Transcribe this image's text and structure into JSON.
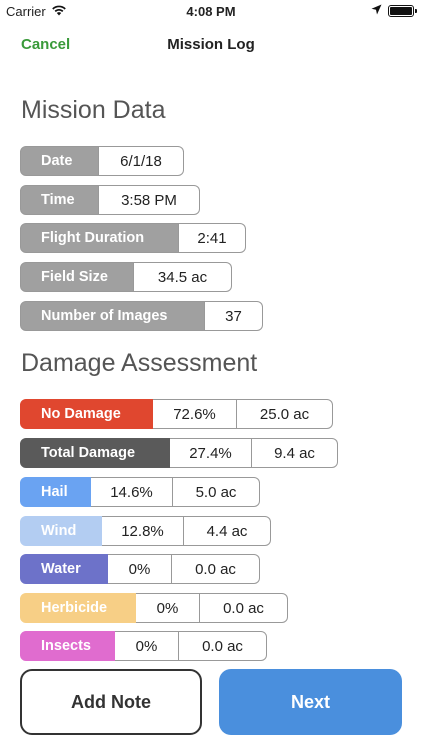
{
  "status": {
    "carrier": "Carrier",
    "time": "4:08 PM"
  },
  "nav": {
    "cancel": "Cancel",
    "title": "Mission Log"
  },
  "mission": {
    "heading": "Mission Data",
    "date": {
      "label": "Date",
      "value": "6/1/18"
    },
    "time": {
      "label": "Time",
      "value": "3:58 PM"
    },
    "duration": {
      "label": "Flight Duration",
      "value": "2:41"
    },
    "field_size": {
      "label": "Field Size",
      "value": "34.5 ac"
    },
    "images": {
      "label": "Number of Images",
      "value": "37"
    }
  },
  "damage": {
    "heading": "Damage Assessment",
    "rows": [
      {
        "label": "No Damage",
        "pct": "72.6%",
        "area": "25.0 ac",
        "color": "#e0472f"
      },
      {
        "label": "Total Damage",
        "pct": "27.4%",
        "area": "9.4 ac",
        "color": "#5a5a5a"
      },
      {
        "label": "Hail",
        "pct": "14.6%",
        "area": "5.0 ac",
        "color": "#6aa3f2"
      },
      {
        "label": "Wind",
        "pct": "12.8%",
        "area": "4.4 ac",
        "color": "#b3cdf2"
      },
      {
        "label": "Water",
        "pct": "0%",
        "area": "0.0 ac",
        "color": "#6d72c9"
      },
      {
        "label": "Herbicide",
        "pct": "0%",
        "area": "0.0 ac",
        "color": "#f7cf86"
      },
      {
        "label": "Insects",
        "pct": "0%",
        "area": "0.0 ac",
        "color": "#e06ccf"
      }
    ]
  },
  "buttons": {
    "add_note": "Add Note",
    "next": "Next"
  }
}
